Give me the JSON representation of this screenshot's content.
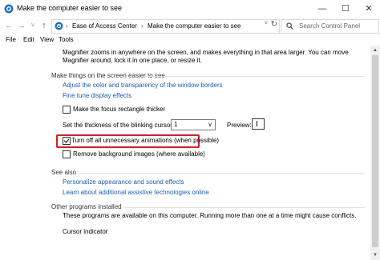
{
  "window": {
    "title": "Make the computer easier to see",
    "minimize_glyph": "—",
    "maximize_glyph": "☐",
    "close_glyph": "✕"
  },
  "nav": {
    "back_glyph": "←",
    "forward_glyph": "→",
    "recent_glyph": "˅",
    "up_glyph": "↑"
  },
  "address": {
    "crumbs": [
      "Ease of Access Center",
      "Make the computer easier to see"
    ],
    "separator": "›",
    "dropdown_glyph": "˅",
    "refresh_glyph": "↻"
  },
  "search": {
    "placeholder": "Search Control Panel"
  },
  "menu": {
    "file": "File",
    "edit": "Edit",
    "view": "View",
    "tools": "Tools"
  },
  "magnifier_desc": [
    "Magnifier zooms in anywhere on the screen, and makes everything in that area larger. You can move",
    "Magnifier around, lock it in one place, or resize it."
  ],
  "section_easier": {
    "heading": "Make things on the screen easier to see",
    "link_borders": "Adjust the color and transparency of the window borders",
    "link_display": "Fine tune display effects",
    "focus_rect_label": "Make the focus rectangle thicker",
    "focus_rect_checked": false,
    "cursor_label": "Set the thickness of the blinking cursor:",
    "cursor_value": "1",
    "select_arrow": "∨",
    "preview_label": "Preview:",
    "animations_label": "Turn off all unnecessary animations (when possible)",
    "animations_checked": true,
    "background_label": "Remove background images (where available)",
    "background_checked": false
  },
  "see_also": {
    "heading": "See also",
    "link_personalize": "Personalize appearance and sound effects",
    "link_assistive": "Learn about additional assistive technologies online"
  },
  "other_programs": {
    "heading": "Other programs installed",
    "description": "These programs are available on this computer. Running more than one at a time might cause conflicts.",
    "cursor_indicator": "Cursor indicator"
  },
  "colors": {
    "link": "#1a5fb4",
    "highlight_border": "#d0202c"
  }
}
